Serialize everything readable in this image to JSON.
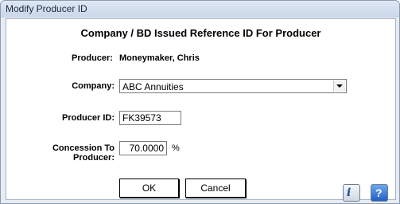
{
  "window": {
    "title": "Modify Producer ID"
  },
  "dialog": {
    "heading": "Company / BD Issued Reference ID For Producer",
    "producer_label": "Producer:",
    "producer_value": "Moneymaker, Chris",
    "company_label": "Company:",
    "company_value": "ABC Annuities",
    "producer_id_label": "Producer ID:",
    "producer_id_value": "FK39573",
    "concession_label": "Concession To Producer:",
    "concession_value": "70.0000",
    "concession_unit": "%"
  },
  "buttons": {
    "ok": "OK",
    "cancel": "Cancel"
  },
  "icons": {
    "info_glyph": "i",
    "help_glyph": "?"
  }
}
